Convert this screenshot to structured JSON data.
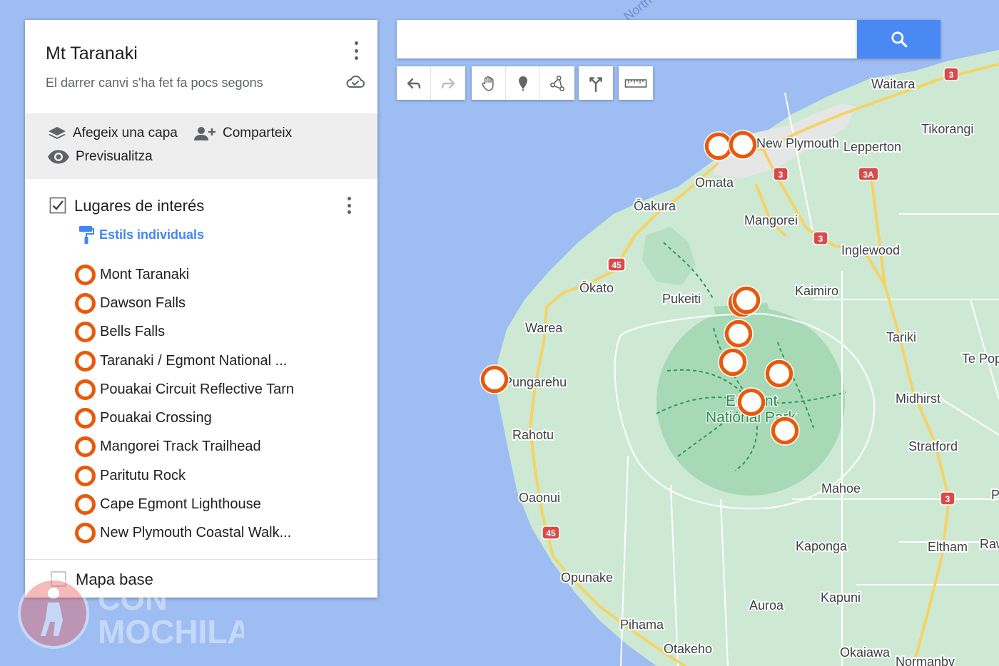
{
  "panel": {
    "title": "Mt Taranaki",
    "subtitle": "El darrer canvi s'ha fet fa pocs segons",
    "actions": {
      "add_layer": "Afegeix una capa",
      "share": "Comparteix",
      "preview": "Previsualitza"
    },
    "layer": {
      "title": "Lugares de interés",
      "style_link": "Estils individuals",
      "checked": true,
      "items": [
        "Mont Taranaki",
        "Dawson Falls",
        "Bells Falls",
        "Taranaki / Egmont National ...",
        "Pouakai Circuit Reflective Tarn",
        "Pouakai Crossing",
        "Mangorei Track Trailhead",
        "Paritutu Rock",
        "Cape Egmont Lighthouse",
        "New Plymouth Coastal Walk..."
      ]
    },
    "base_map": {
      "label": "Mapa base",
      "checked": false
    }
  },
  "search": {
    "placeholder": "",
    "value": ""
  },
  "toolbar": {
    "icons": [
      "undo-icon",
      "redo-icon",
      "hand-icon",
      "marker-icon",
      "draw-line-icon",
      "directions-icon",
      "ruler-icon"
    ]
  },
  "map": {
    "places": {
      "waitara": "Waitara",
      "tikorangi": "Tikorangi",
      "new_plymouth": "New Plymouth",
      "lepperton": "Lepperton",
      "omata": "Omata",
      "oakura": "Ōakura",
      "mangorei": "Mangorei",
      "inglewood": "Inglewood",
      "okato": "Ōkato",
      "pukeiti": "Pukeiti",
      "kaimiro": "Kaimiro",
      "warea": "Warea",
      "tariki": "Tariki",
      "te_popo": "Te Popo",
      "pungarehu": "Pungarehu",
      "midhirst": "Midhirst",
      "rahotu": "Rahotu",
      "stratford": "Stratford",
      "mahoe": "Mahoe",
      "oaonui": "Oaonui",
      "kaponga": "Kaponga",
      "eltham": "Eltham",
      "raw": "Raw",
      "p_edge": "P",
      "p_edge2": "P",
      "opunake": "Opunake",
      "kapuni": "Kapuni",
      "auroa": "Auroa",
      "pihama": "Pihama",
      "otakeho": "Otakeho",
      "okaiawa": "Okaiawa",
      "normanby": "Normanby"
    },
    "park_label": [
      "Egmont",
      "National Park"
    ],
    "water_label": "North Taranaki Bight",
    "highway_shields": [
      "3",
      "3",
      "3A",
      "3",
      "45",
      "45",
      "3"
    ],
    "colors": {
      "water": "#9ebdf3",
      "land": "#cde9d4",
      "park": "#a8d9b6",
      "marker": "#e8590c",
      "road": "#f6d365"
    }
  },
  "watermark": {
    "line1": "CON",
    "line2": "MOCHILA"
  }
}
